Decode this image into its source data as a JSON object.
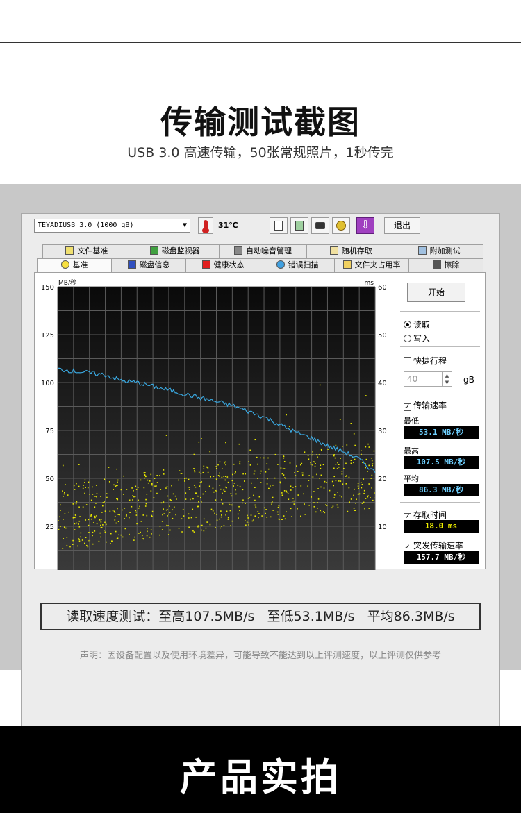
{
  "hero": {
    "title": "传输测试截图",
    "subtitle": "USB 3.0 高速传输，50张常规照片，1秒传完"
  },
  "app": {
    "drive": "TEYADIUSB 3.0 (1000 gB)",
    "temperature": "31℃",
    "exit_label": "退出",
    "toolbar_icons": [
      "copy-text-icon",
      "copy-image-icon",
      "camera-icon",
      "settings-icon",
      "download-icon"
    ],
    "tabs_row1": [
      {
        "label": "文件基准",
        "icon": "file-benchmark-icon"
      },
      {
        "label": "磁盘监视器",
        "icon": "disk-monitor-icon"
      },
      {
        "label": "自动噪音管理",
        "icon": "speaker-icon"
      },
      {
        "label": "随机存取",
        "icon": "random-access-icon"
      },
      {
        "label": "附加测试",
        "icon": "extra-tests-icon"
      }
    ],
    "tabs_row2": [
      {
        "label": "基准",
        "icon": "lightbulb-icon",
        "active": true
      },
      {
        "label": "磁盘信息",
        "icon": "info-icon"
      },
      {
        "label": "健康状态",
        "icon": "health-cross-icon"
      },
      {
        "label": "错误扫描",
        "icon": "magnifier-icon"
      },
      {
        "label": "文件夹占用率",
        "icon": "folder-icon"
      },
      {
        "label": "擦除",
        "icon": "trash-icon"
      }
    ],
    "side": {
      "start_label": "开始",
      "read_label": "读取",
      "write_label": "写入",
      "mode": "read",
      "quick_label": "快捷行程",
      "quick_checked": false,
      "quick_value": "40",
      "quick_unit": "gB",
      "transfer_label": "传输速率",
      "transfer_checked": true,
      "min_label": "最低",
      "min_value": "53.1 MB/秒",
      "max_label": "最高",
      "max_value": "107.5 MB/秒",
      "avg_label": "平均",
      "avg_value": "86.3 MB/秒",
      "access_label": "存取时间",
      "access_checked": true,
      "access_value": "18.0 ms",
      "burst_label": "突发传输速率",
      "burst_checked": true,
      "burst_value": "157.7 MB/秒"
    }
  },
  "chart_data": {
    "type": "line",
    "left_axis_label": "MB/秒",
    "right_axis_label": "ms",
    "left_ticks": [
      "150",
      "125",
      "100",
      "75",
      "50",
      "25"
    ],
    "right_ticks": [
      "60",
      "50",
      "40",
      "30",
      "20",
      "10"
    ],
    "ylim_left": [
      0,
      150
    ],
    "ylim_right": [
      0,
      60
    ],
    "series": [
      {
        "name": "传输速率",
        "color": "#3aa8e0",
        "x": [
          0,
          5,
          10,
          15,
          20,
          25,
          30,
          35,
          40,
          45,
          50,
          55,
          60,
          65,
          70,
          75,
          80,
          85,
          90,
          95,
          100
        ],
        "values": [
          107,
          106,
          105,
          104,
          101,
          100,
          98,
          96,
          94,
          92,
          90,
          88,
          85,
          82,
          78,
          74,
          71,
          67,
          64,
          60,
          53
        ]
      }
    ],
    "access_scatter": {
      "color": "#e8e800",
      "x_range": [
        0,
        100
      ],
      "y_range_ms": [
        8,
        30
      ]
    },
    "grid": true
  },
  "summary": {
    "text": "读取速度测试：至高107.5MB/s   至低53.1MB/s   平均86.3MB/s",
    "disclaimer": "声明：因设备配置以及使用环境差异，可能导致不能达到以上评测速度，以上评测仅供参考"
  },
  "footer": {
    "title": "产品实拍"
  }
}
